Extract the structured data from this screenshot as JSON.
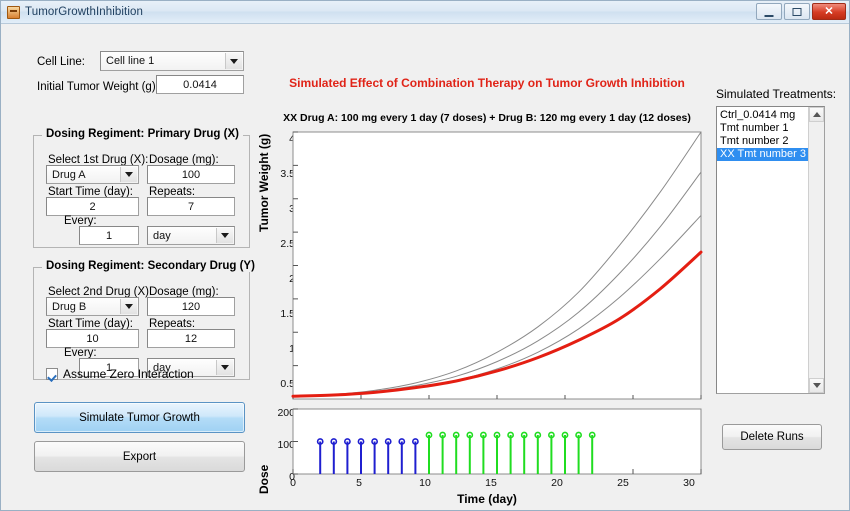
{
  "window": {
    "title": "TumorGrowthInhibition",
    "icon": "matlab-figure-icon",
    "buttons": {
      "minimize": "minimize-button",
      "maximize": "maximize-button",
      "close": "close-button",
      "close_glyph": "✕"
    }
  },
  "form": {
    "cell_line_label": "Cell Line:",
    "cell_line_value": "Cell line 1",
    "initial_weight_label": "Initial Tumor Weight (g):",
    "initial_weight_value": "0.0414",
    "primary": {
      "group_title": "Dosing Regiment: Primary Drug (X)",
      "select_label": "Select 1st Drug (X):",
      "select_value": "Drug A",
      "dosage_label": "Dosage (mg):",
      "dosage_value": "100",
      "start_label": "Start Time (day):",
      "start_value": "2",
      "repeats_label": "Repeats:",
      "repeats_value": "7",
      "every_label": "Every:",
      "every_value": "1",
      "every_unit": "day"
    },
    "secondary": {
      "group_title": "Dosing Regiment: Secondary Drug (Y)",
      "select_label": "Select 2nd Drug (X):",
      "select_value": "Drug B",
      "dosage_label": "Dosage (mg):",
      "dosage_value": "120",
      "start_label": "Start Time (day):",
      "start_value": "10",
      "repeats_label": "Repeats:",
      "repeats_value": "12",
      "every_label": "Every:",
      "every_value": "1",
      "every_unit": "day"
    },
    "zero_interaction_label": "Assume Zero Interaction",
    "zero_interaction_checked": true,
    "simulate_button": "Simulate Tumor Growth",
    "export_button": "Export"
  },
  "treatments": {
    "header": "Simulated Treatments:",
    "items": [
      {
        "label": "Ctrl_0.0414 mg",
        "selected": false
      },
      {
        "label": "Tmt number 1",
        "selected": false
      },
      {
        "label": "Tmt number 2",
        "selected": false
      },
      {
        "label": "XX Tmt number 3",
        "selected": true
      }
    ],
    "delete_button": "Delete Runs"
  },
  "chart_data": {
    "type": "line",
    "title": "Simulated Effect of Combination Therapy on Tumor Growth Inhibition",
    "subtitle": "XX Drug A: 100 mg every 1 day (7 doses) + Drug B: 120 mg every 1 day (12 doses)",
    "title_color": "#e02418",
    "xlabel": "Time (day)",
    "ylabel": "Tumor Weight (g)",
    "xlim": [
      0,
      30
    ],
    "ylim": [
      0,
      4
    ],
    "xticks": [
      0,
      5,
      10,
      15,
      20,
      25,
      30
    ],
    "yticks": [
      0.5,
      1,
      1.5,
      2,
      2.5,
      3,
      3.5,
      4
    ],
    "ytick_labels": [
      "0.5",
      "1",
      "1.5",
      "2",
      "2.5",
      "3",
      "3.5",
      "4"
    ],
    "grid": false,
    "legend": "none",
    "series": [
      {
        "name": "Ctrl_0.0414 mg",
        "color": "#8a8a8a",
        "width": 1,
        "x": [
          0,
          3,
          6,
          9,
          12,
          15,
          18,
          21,
          24,
          27,
          30
        ],
        "y": [
          0.0414,
          0.07,
          0.13,
          0.24,
          0.42,
          0.7,
          1.08,
          1.6,
          2.3,
          3.1,
          4.0
        ]
      },
      {
        "name": "Tmt number 1",
        "color": "#8a8a8a",
        "width": 1,
        "x": [
          0,
          3,
          6,
          9,
          12,
          15,
          18,
          21,
          24,
          27,
          30
        ],
        "y": [
          0.0414,
          0.065,
          0.115,
          0.2,
          0.34,
          0.56,
          0.87,
          1.3,
          1.88,
          2.58,
          3.4
        ]
      },
      {
        "name": "Tmt number 2",
        "color": "#8a8a8a",
        "width": 1,
        "x": [
          0,
          3,
          6,
          9,
          12,
          15,
          18,
          21,
          24,
          27,
          30
        ],
        "y": [
          0.0414,
          0.06,
          0.1,
          0.17,
          0.28,
          0.45,
          0.7,
          1.05,
          1.52,
          2.1,
          2.75
        ]
      },
      {
        "name": "XX Tmt number 3",
        "color": "#e41e12",
        "width": 3,
        "x": [
          0,
          3,
          6,
          9,
          12,
          15,
          18,
          21,
          24,
          27,
          30
        ],
        "y": [
          0.0414,
          0.06,
          0.1,
          0.17,
          0.27,
          0.42,
          0.62,
          0.88,
          1.2,
          1.65,
          2.2
        ]
      }
    ],
    "dose_panel": {
      "ylabel": "Dose",
      "ylim": [
        0,
        200
      ],
      "yticks": [
        0,
        100,
        200
      ],
      "ytick_labels": [
        "0",
        "100",
        "200"
      ],
      "stems": [
        {
          "name": "Drug A",
          "color": "#1f1fd0",
          "dose": 100,
          "days": [
            2,
            3,
            4,
            5,
            6,
            7,
            8,
            9
          ]
        },
        {
          "name": "Drug B",
          "color": "#20dd20",
          "dose": 120,
          "days": [
            10,
            11,
            12,
            13,
            14,
            15,
            16,
            17,
            18,
            19,
            20,
            21,
            22
          ]
        }
      ]
    }
  }
}
